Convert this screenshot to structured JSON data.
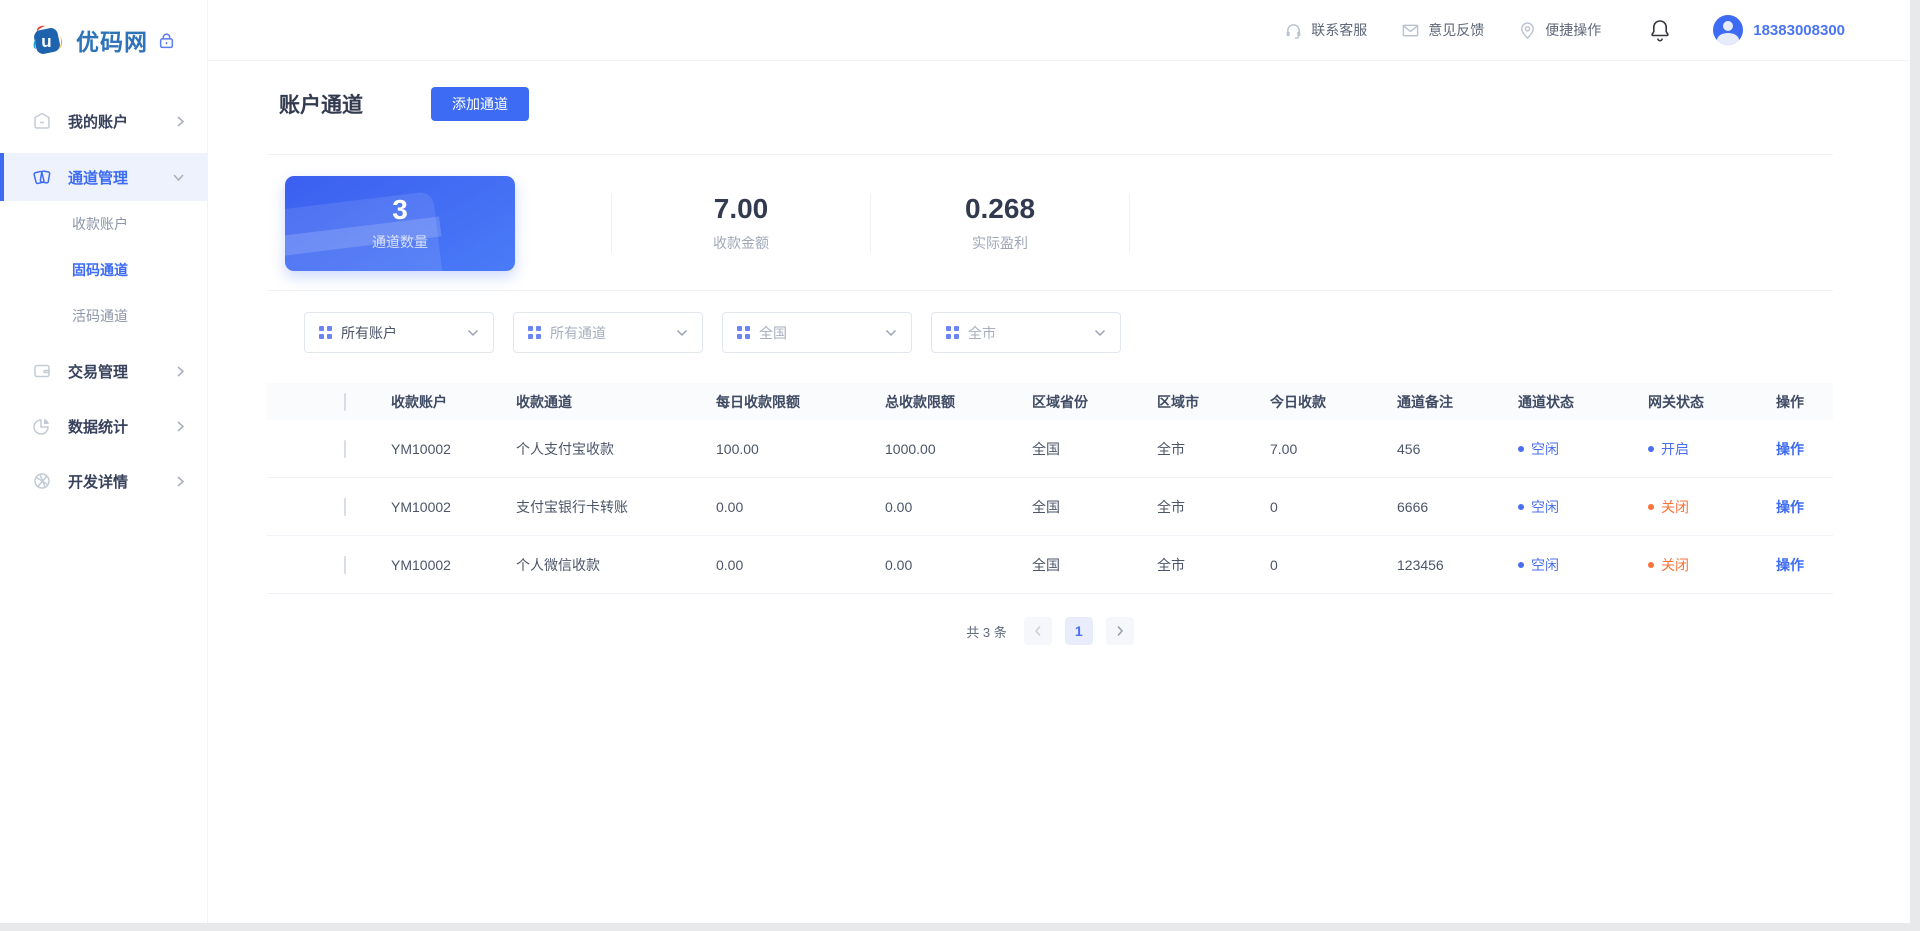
{
  "brand": {
    "name": "优码网"
  },
  "topbar": {
    "links": [
      {
        "label": "联系客服"
      },
      {
        "label": "意见反馈"
      },
      {
        "label": "便捷操作"
      }
    ],
    "phone": "18383008300"
  },
  "sidebar": {
    "items": [
      {
        "label": "我的账户"
      },
      {
        "label": "通道管理"
      },
      {
        "label": "收款账户"
      },
      {
        "label": "固码通道"
      },
      {
        "label": "活码通道"
      },
      {
        "label": "交易管理"
      },
      {
        "label": "数据统计"
      },
      {
        "label": "开发详情"
      }
    ]
  },
  "page": {
    "title": "账户通道",
    "add_button_label": "添加通道"
  },
  "stats": [
    {
      "value": "3",
      "label": "通道数量"
    },
    {
      "value": "7.00",
      "label": "收款金额"
    },
    {
      "value": "0.268",
      "label": "实际盈利"
    }
  ],
  "filters": [
    {
      "value": "所有账户"
    },
    {
      "value": "所有通道"
    },
    {
      "value": "全国"
    },
    {
      "value": "全市"
    }
  ],
  "table": {
    "headers": [
      "收款账户",
      "收款通道",
      "每日收款限额",
      "总收款限额",
      "区域省份",
      "区域市",
      "今日收款",
      "通道备注",
      "通道状态",
      "网关状态",
      "操作"
    ],
    "rows": [
      {
        "account": "YM10002",
        "channel": "个人支付宝收款",
        "daily_limit": "100.00",
        "total_limit": "1000.00",
        "province": "全国",
        "city": "全市",
        "today_amount": "7.00",
        "remark": "456",
        "channel_status": "空闲",
        "gateway_status": "开启",
        "action": "操作"
      },
      {
        "account": "YM10002",
        "channel": "支付宝银行卡转账",
        "daily_limit": "0.00",
        "total_limit": "0.00",
        "province": "全国",
        "city": "全市",
        "today_amount": "0",
        "remark": "6666",
        "channel_status": "空闲",
        "gateway_status": "关闭",
        "action": "操作"
      },
      {
        "account": "YM10002",
        "channel": "个人微信收款",
        "daily_limit": "0.00",
        "total_limit": "0.00",
        "province": "全国",
        "city": "全市",
        "today_amount": "0",
        "remark": "123456",
        "channel_status": "空闲",
        "gateway_status": "关闭",
        "action": "操作"
      }
    ]
  },
  "pagination": {
    "total_text": "共 3 条",
    "page": "1"
  },
  "colors": {
    "primary": "#3D6BF3",
    "primary_light_bg": "#EDF2FD",
    "status_blue": "#4A6EF2",
    "status_orange": "#F97239",
    "brand_blue": "#2E73B8"
  }
}
